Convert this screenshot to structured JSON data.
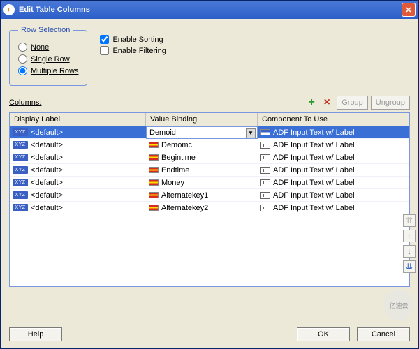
{
  "window": {
    "title": "Edit Table Columns"
  },
  "rowSelection": {
    "legend": "Row Selection",
    "none": "None",
    "single": "Single Row",
    "multiple": "Multiple Rows",
    "selected": "multiple"
  },
  "options": {
    "enableSorting": {
      "label": "Enable Sorting",
      "checked": true
    },
    "enableFiltering": {
      "label": "Enable Filtering",
      "checked": false
    }
  },
  "columnsLabel": "Columns:",
  "toolbar": {
    "add": "+",
    "remove": "×",
    "group": "Group",
    "ungroup": "Ungroup"
  },
  "headers": {
    "displayLabel": "Display Label",
    "valueBinding": "Value Binding",
    "componentToUse": "Component To Use"
  },
  "rows": [
    {
      "label": "<default>",
      "binding": "Demoid",
      "component": "ADF Input Text w/ Label",
      "selected": true
    },
    {
      "label": "<default>",
      "binding": "Demomc",
      "component": "ADF Input Text w/ Label",
      "selected": false
    },
    {
      "label": "<default>",
      "binding": "Begintime",
      "component": "ADF Input Text w/ Label",
      "selected": false
    },
    {
      "label": "<default>",
      "binding": "Endtime",
      "component": "ADF Input Text w/ Label",
      "selected": false
    },
    {
      "label": "<default>",
      "binding": "Money",
      "component": "ADF Input Text w/ Label",
      "selected": false
    },
    {
      "label": "<default>",
      "binding": "Alternatekey1",
      "component": "ADF Input Text w/ Label",
      "selected": false
    },
    {
      "label": "<default>",
      "binding": "Alternatekey2",
      "component": "ADF Input Text w/ Label",
      "selected": false
    }
  ],
  "footer": {
    "help": "Help",
    "ok": "OK",
    "cancel": "Cancel"
  },
  "watermark": "亿速云"
}
